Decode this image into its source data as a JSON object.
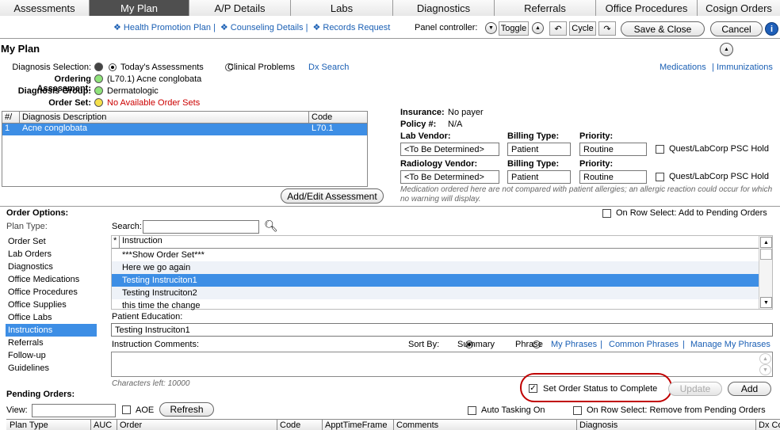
{
  "tabs": [
    {
      "label": "Assessments"
    },
    {
      "label": "My Plan"
    },
    {
      "label": "A/P Details"
    },
    {
      "label": "Labs"
    },
    {
      "label": "Diagnostics"
    },
    {
      "label": "Referrals"
    },
    {
      "label": "Office Procedures"
    },
    {
      "label": "Cosign Orders"
    }
  ],
  "toplinks": {
    "health_promotion": "❖ Health Promotion Plan |",
    "counseling": "❖ Counseling Details |",
    "records": "❖ Records Request"
  },
  "panel": {
    "label": "Panel controller:",
    "toggle": "Toggle",
    "cycle": "Cycle",
    "save_close": "Save & Close",
    "cancel": "Cancel"
  },
  "title": "My Plan",
  "diagnosis": {
    "selection_label": "Diagnosis Selection:",
    "todays_assessments": "Today's Assessments",
    "clinical_problems": "Clinical Problems",
    "dx_search": "Dx Search",
    "ordering_label": "Ordering Assessment:",
    "ordering_value": "(L70.1) Acne conglobata",
    "group_label": "Diagnosis Group:",
    "group_value": "Dermatologic",
    "orderset_label": "Order Set:",
    "orderset_value": "No Available Order Sets"
  },
  "right_links": {
    "medications": "Medications",
    "separator": "|",
    "immunizations": "Immunizations"
  },
  "diag_table": {
    "col_num": "#/",
    "col_desc": "Diagnosis Description",
    "col_code": "Code",
    "rows": [
      {
        "num": "1",
        "desc": "Acne conglobata",
        "code": "L70.1"
      }
    ]
  },
  "add_edit_button": "Add/Edit Assessment",
  "insurance": {
    "insurance_label": "Insurance:",
    "insurance_value": "No payer",
    "policy_label": "Policy #:",
    "policy_value": "N/A",
    "lab_vendor_label": "Lab Vendor:",
    "lab_vendor_value": "<To Be Determined>",
    "billing_label": "Billing Type:",
    "billing_value": "Patient",
    "priority_label": "Priority:",
    "priority_value": "Routine",
    "quest_label": "Quest/LabCorp PSC Hold",
    "rad_vendor_label": "Radiology Vendor:",
    "rad_vendor_value": "<To Be Determined>",
    "rad_billing_label": "Billing Type:",
    "rad_billing_value": "Patient",
    "rad_priority_label": "Priority:",
    "rad_priority_value": "Routine",
    "rad_quest_label": "Quest/LabCorp PSC Hold",
    "warning": "Medication ordered here are not compared with patient allergies; an allergic reaction could occur for which no warning will display."
  },
  "order_options": {
    "label": "Order Options:",
    "on_row_select_add": "On Row Select: Add to Pending Orders",
    "plan_type_label": "Plan Type:",
    "search_label": "Search:",
    "plan_types": [
      "Order Set",
      "Lab Orders",
      "Diagnostics",
      "Office Medications",
      "Office Procedures",
      "Office Supplies",
      "Office Labs",
      "Instructions",
      "Referrals",
      "Follow-up",
      "Guidelines"
    ],
    "selected_plan_type": "Instructions",
    "instr_col_star": "*",
    "instr_col_label": "Instruction",
    "instructions": [
      "***Show Order Set***",
      "Here we go again",
      "Testing Instruciton1",
      "Testing Instruciton2",
      "this time the change"
    ],
    "selected_instruction": "Testing Instruciton1",
    "patient_education_label": "Patient Education:",
    "patient_education_value": "Testing Instruciton1",
    "instruction_comments_label": "Instruction Comments:",
    "sort_by_label": "Sort By:",
    "sort_summary": "Summary",
    "sort_phrase": "Phrase",
    "my_phrases": "My Phrases",
    "common_phrases": "Common Phrases",
    "manage_phrases": "Manage My Phrases",
    "pipe": "|",
    "chars_left": "Characters left: 10000",
    "set_status_complete": "Set Order Status to Complete",
    "update": "Update",
    "add": "Add"
  },
  "pending": {
    "label": "Pending Orders:",
    "view_label": "View:",
    "aoe": "AOE",
    "refresh": "Refresh",
    "auto_tasking": "Auto Tasking On",
    "on_row_select_remove": "On Row Select: Remove from Pending Orders",
    "columns": [
      "Plan Type",
      "AUC",
      "Order",
      "Code",
      "ApptTimeFrame",
      "Comments",
      "Diagnosis",
      "Dx Co"
    ]
  },
  "colors": {
    "selection_blue": "#3d8ee5",
    "link_blue": "#1a5fb4",
    "error_red": "#cc0000",
    "highlight_circle": "#c00000"
  }
}
